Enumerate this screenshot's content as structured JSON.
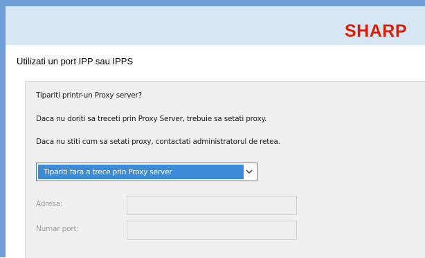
{
  "header": {
    "brand": "SHARP",
    "brand_color": "#d81e05",
    "banner_color": "#d7e6f5",
    "frame_color": "#6f9fd6"
  },
  "page": {
    "title": "Utilizati un port IPP sau IPPS"
  },
  "proxy": {
    "question": "Tipariti printr-un Proxy server?",
    "info_1": "Daca nu doriti sa treceti prin Proxy Server, trebuie sa setati proxy.",
    "info_2": "Daca nu stiti cum sa setati proxy, contactati administratorul de retea.",
    "selected_option": "Tipariti fara a trece prin Proxy server",
    "address_label": "Adresa:",
    "address_value": "",
    "port_label": "Numar port:",
    "port_value": ""
  }
}
